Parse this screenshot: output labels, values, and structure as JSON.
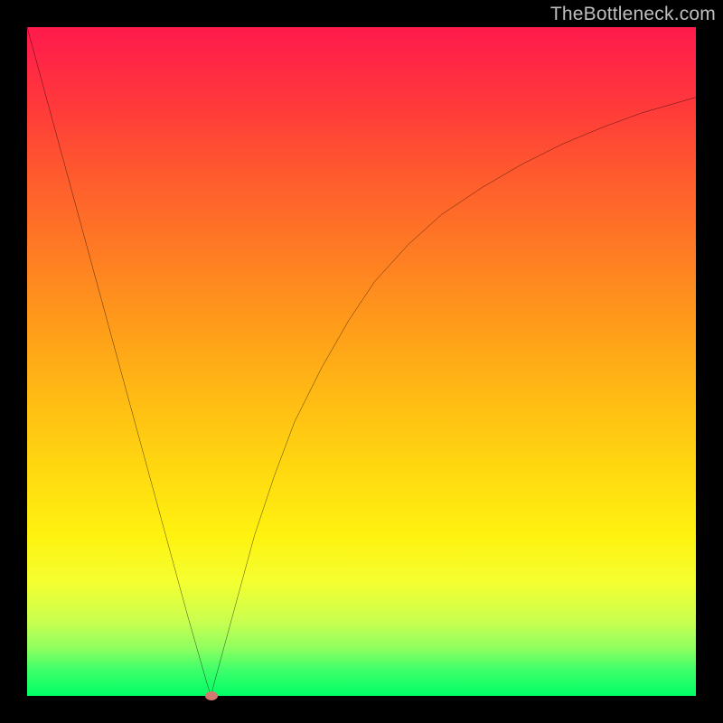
{
  "watermark": "TheBottleneck.com",
  "chart_data": {
    "type": "line",
    "title": "",
    "xlabel": "",
    "ylabel": "",
    "xlim": [
      0,
      100
    ],
    "ylim": [
      0,
      100
    ],
    "grid": false,
    "background_gradient": {
      "orientation": "vertical",
      "stops": [
        {
          "pos": 0,
          "color": "#ff1a4d"
        },
        {
          "pos": 0.33,
          "color": "#ff7a24"
        },
        {
          "pos": 0.66,
          "color": "#ffd810"
        },
        {
          "pos": 0.85,
          "color": "#f4ff30"
        },
        {
          "pos": 1.0,
          "color": "#00ff66"
        }
      ]
    },
    "series": [
      {
        "name": "bottleneck-curve",
        "color": "#000000",
        "x": [
          0,
          3,
          6,
          9,
          12,
          15,
          18,
          21,
          24,
          27,
          27.5,
          28,
          31,
          34,
          37,
          40,
          44,
          48,
          52,
          57,
          62,
          68,
          74,
          80,
          86,
          92,
          100
        ],
        "y": [
          100,
          89,
          78,
          67,
          56,
          45,
          34,
          23,
          12,
          1.5,
          0,
          2,
          13,
          24,
          33,
          41,
          49,
          56,
          62,
          67.5,
          72,
          76,
          79.5,
          82.5,
          85,
          87.2,
          89.5
        ]
      }
    ],
    "marker": {
      "name": "optimal-point",
      "x": 27.5,
      "y": 0,
      "color": "#d07a70"
    }
  }
}
